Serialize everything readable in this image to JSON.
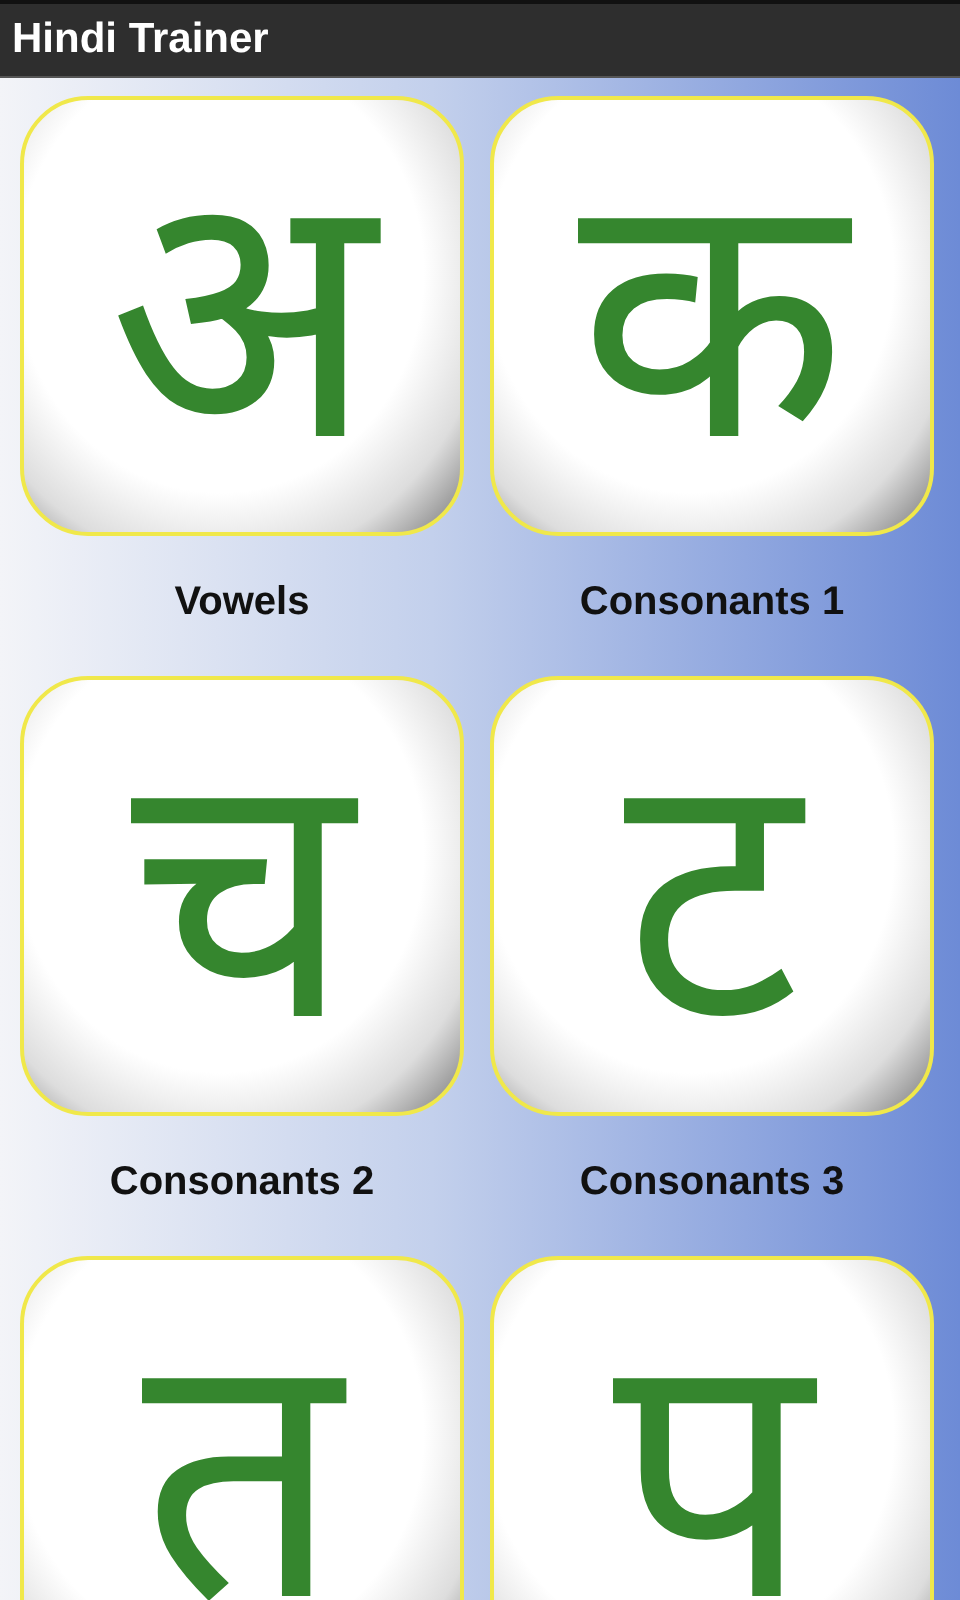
{
  "action_bar": {
    "title": "Hindi Trainer"
  },
  "lessons": [
    {
      "letter": "अ",
      "label": "Vowels"
    },
    {
      "letter": "क",
      "label": "Consonants 1"
    },
    {
      "letter": "च",
      "label": "Consonants 2"
    },
    {
      "letter": "ट",
      "label": "Consonants 3"
    },
    {
      "letter": "त"
    },
    {
      "letter": "प"
    }
  ]
}
